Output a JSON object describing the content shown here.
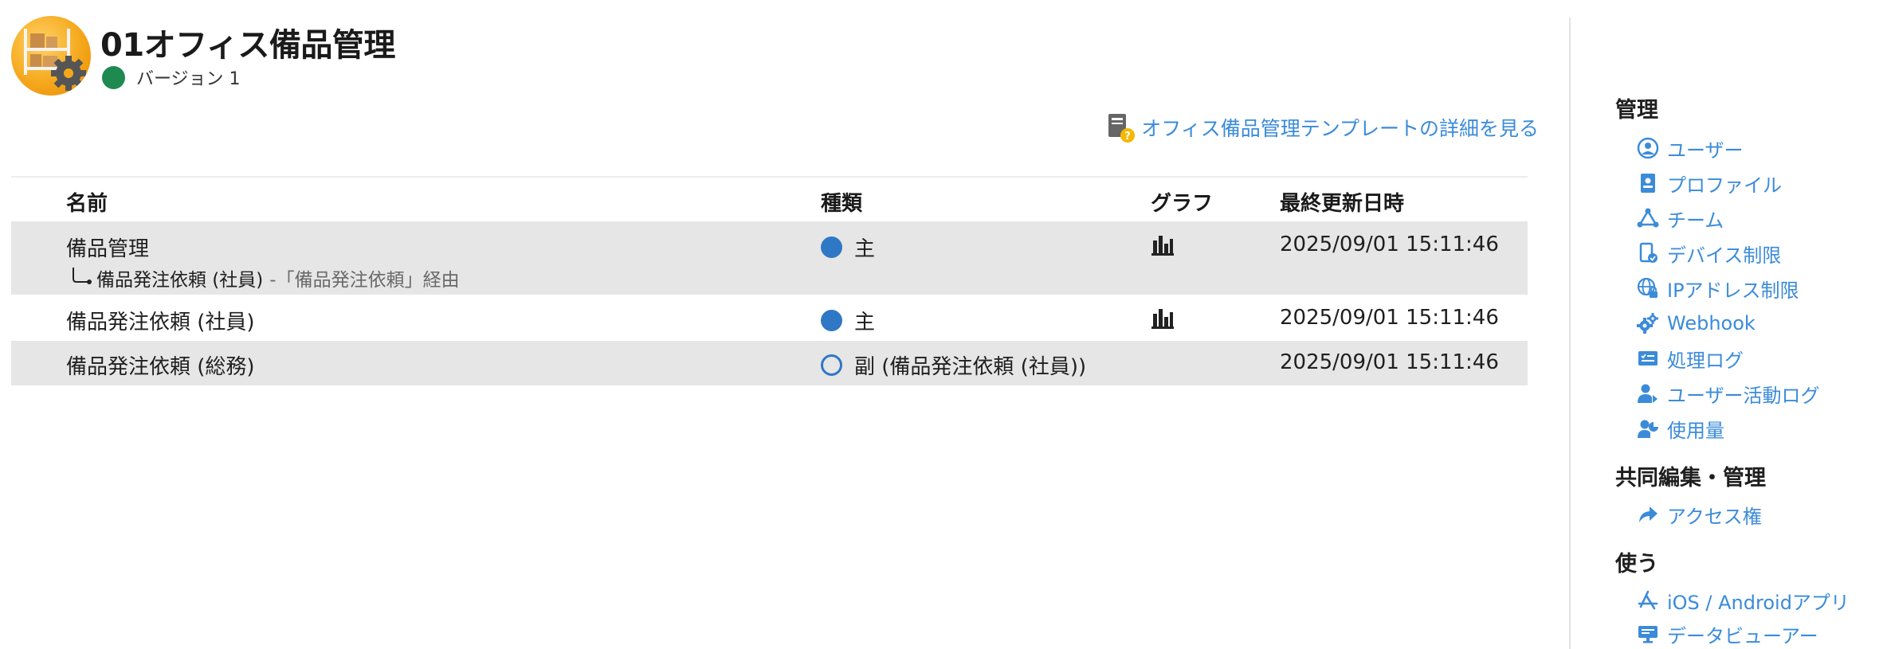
{
  "app": {
    "title": "01オフィス備品管理",
    "version_label": "バージョン 1",
    "version_color": "#1e8a50",
    "icon": "warehouse-gear-icon"
  },
  "template_link": {
    "label": "オフィス備品管理テンプレートの詳細を見る",
    "icon": "book-help-icon"
  },
  "table": {
    "headers": {
      "name": "名前",
      "kind": "種類",
      "graph": "グラフ",
      "updated": "最終更新日時"
    },
    "rows": [
      {
        "name": "備品管理",
        "kind": "主",
        "kind_type": "main",
        "graph": "bar-chart-icon",
        "updated": "2025/09/01 15:11:46",
        "sub": {
          "name": "備品発注依頼 (社員)",
          "via": "-「備品発注依頼」経由"
        }
      },
      {
        "name": "備品発注依頼 (社員)",
        "kind": "主",
        "kind_type": "main",
        "graph": "bar-chart-icon",
        "updated": "2025/09/01 15:11:46"
      },
      {
        "name": "備品発注依頼 (総務)",
        "kind": "副 (備品発注依頼 (社員))",
        "kind_type": "sub",
        "updated": "2025/09/01 15:11:46"
      }
    ]
  },
  "sidebar": {
    "admin": {
      "title": "管理",
      "items": [
        {
          "label": "ユーザー",
          "icon": "user-circle-icon"
        },
        {
          "label": "プロファイル",
          "icon": "profile-card-icon"
        },
        {
          "label": "チーム",
          "icon": "team-icon"
        },
        {
          "label": "デバイス制限",
          "icon": "device-check-icon"
        },
        {
          "label": "IPアドレス制限",
          "icon": "globe-lock-icon"
        },
        {
          "label": "Webhook",
          "icon": "gears-icon"
        },
        {
          "label": "処理ログ",
          "icon": "log-card-icon"
        },
        {
          "label": "ユーザー活動ログ",
          "icon": "user-activity-icon"
        },
        {
          "label": "使用量",
          "icon": "usage-icon"
        }
      ]
    },
    "collab": {
      "title": "共同編集・管理",
      "items": [
        {
          "label": "アクセス権",
          "icon": "share-arrow-icon"
        }
      ]
    },
    "use": {
      "title": "使う",
      "items": [
        {
          "label": "iOS / Androidアプリ",
          "icon": "app-store-icon"
        },
        {
          "label": "データビューアー",
          "icon": "monitor-icon"
        }
      ]
    }
  },
  "colors": {
    "link": "#3b8bd9",
    "kind_dot": "#2f78c6",
    "row_shade": "#e6e6e6"
  }
}
